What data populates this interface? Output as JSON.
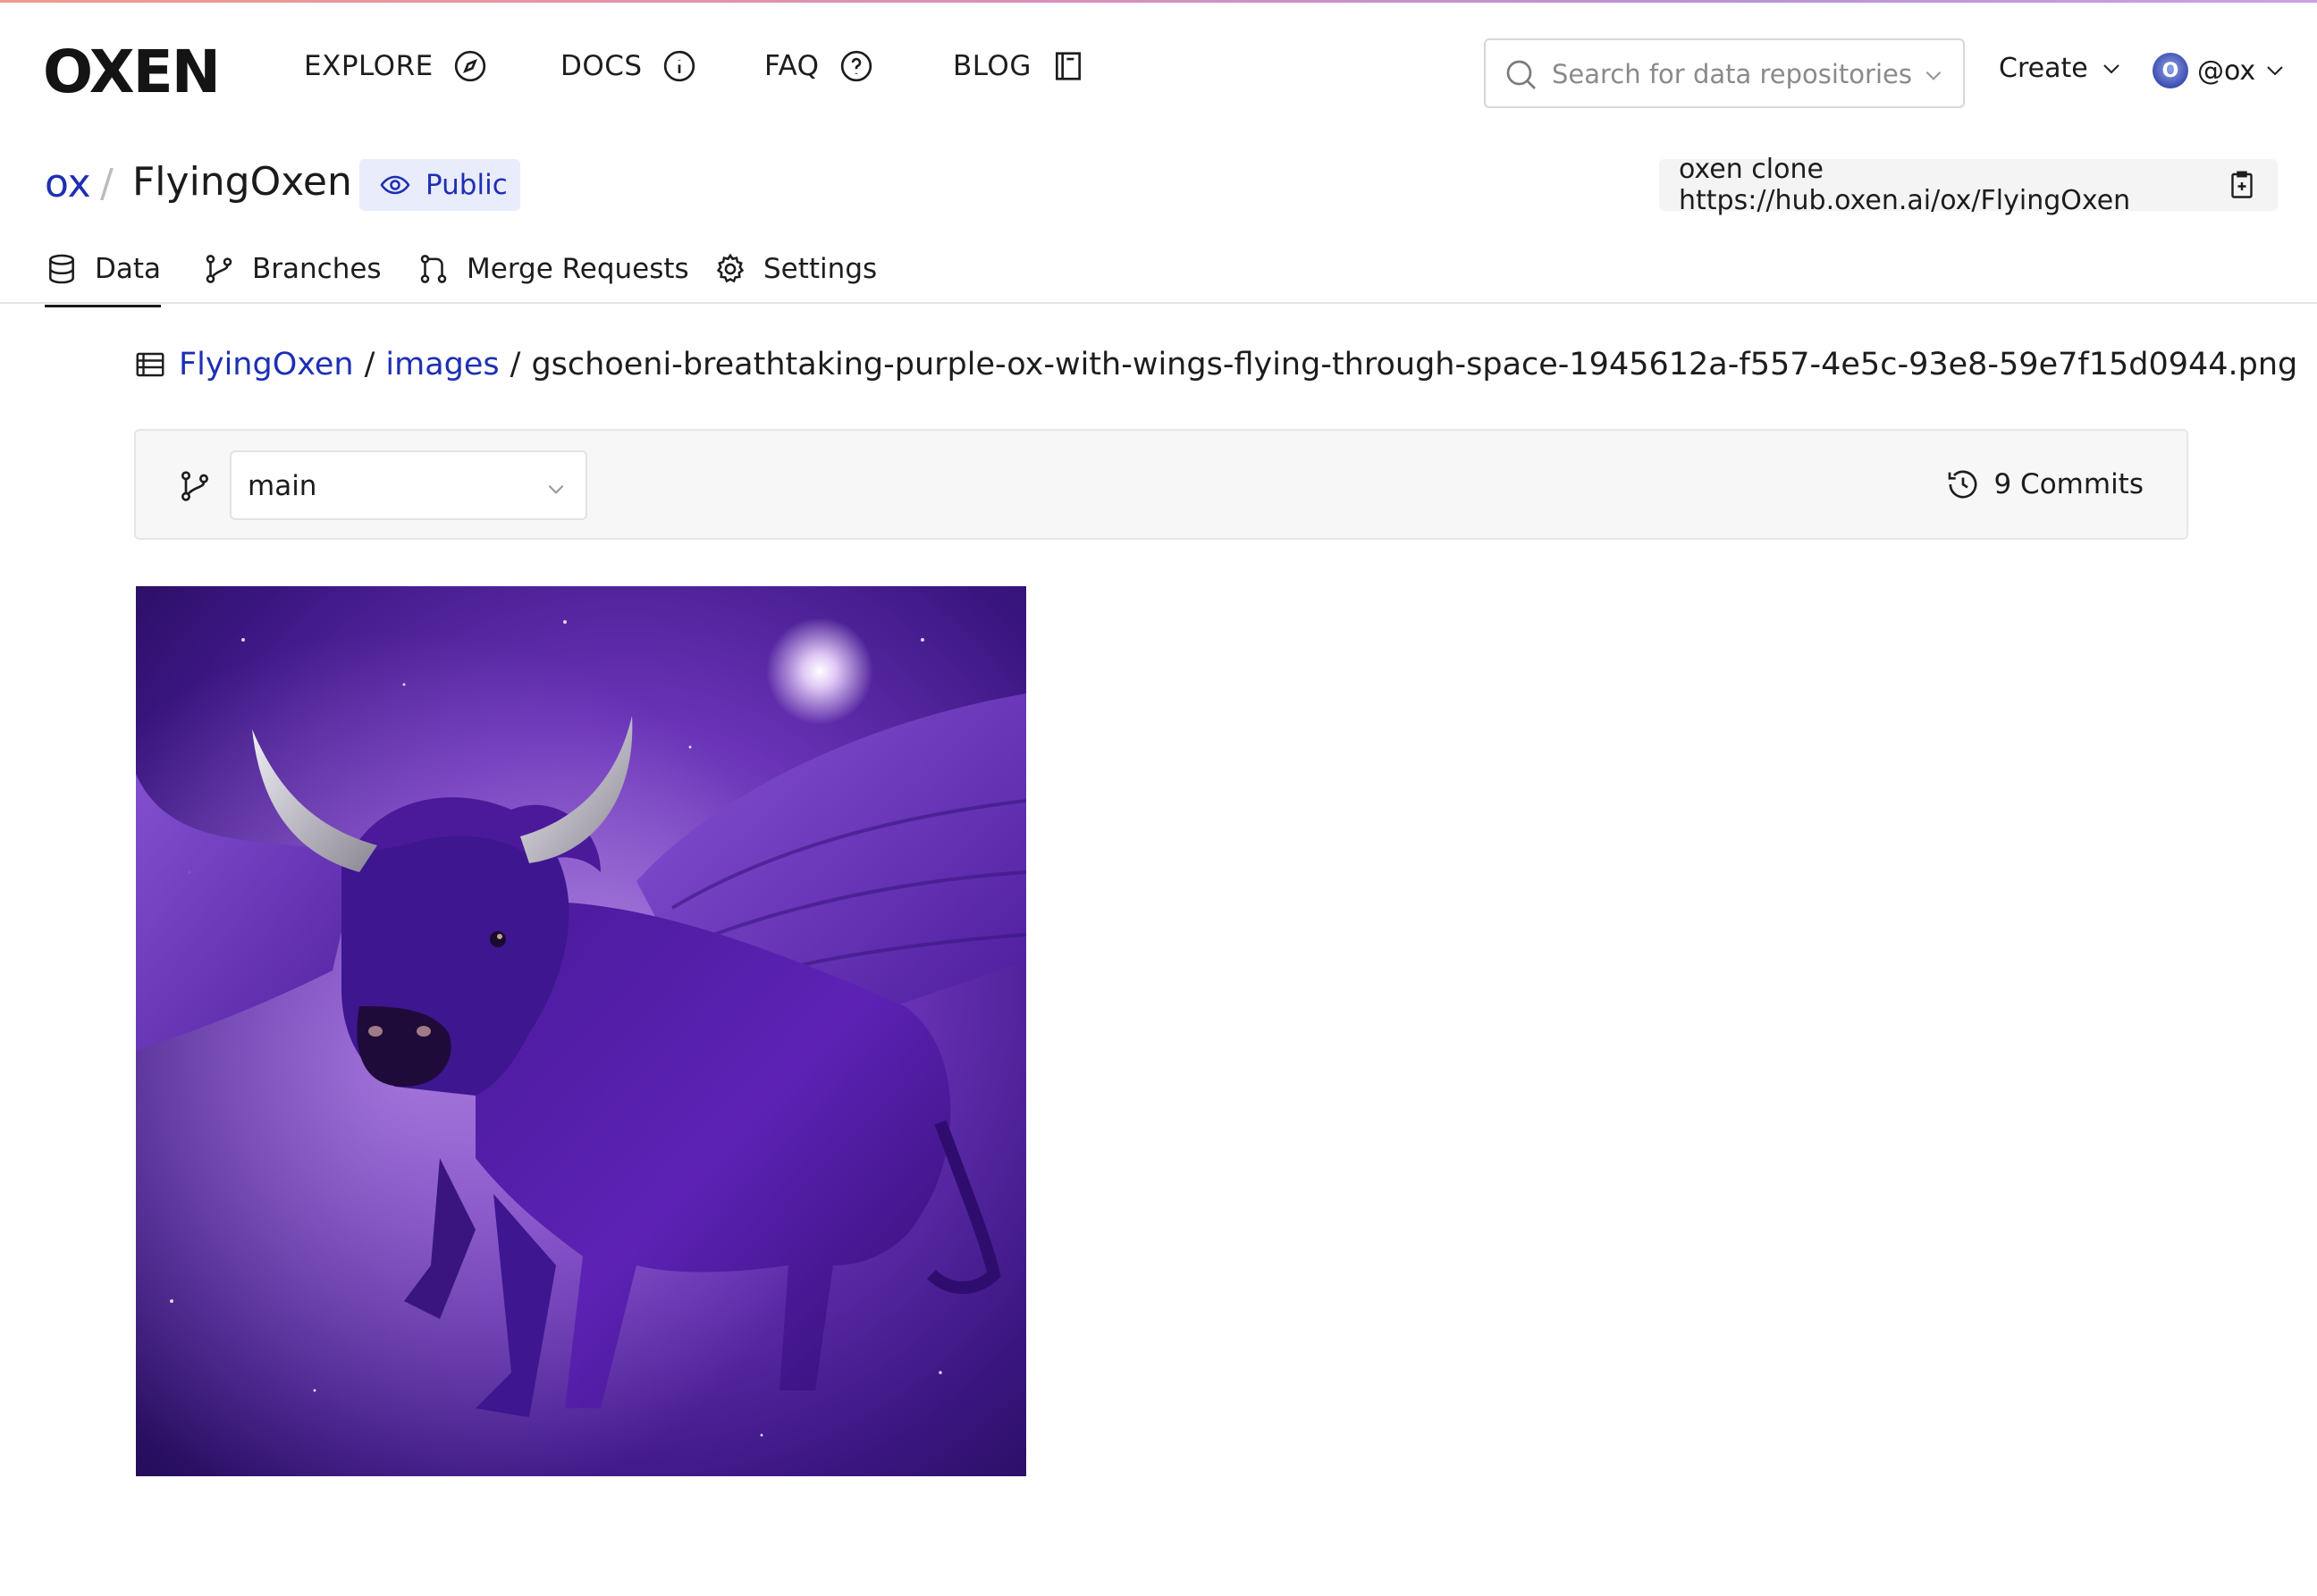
{
  "header": {
    "logo": "OXEN",
    "nav": [
      {
        "label": "EXPLORE",
        "icon": "compass-icon"
      },
      {
        "label": "DOCS",
        "icon": "info-icon"
      },
      {
        "label": "FAQ",
        "icon": "question-icon"
      },
      {
        "label": "BLOG",
        "icon": "book-icon"
      }
    ],
    "search_placeholder": "Search for data repositories",
    "create_label": "Create",
    "avatar_letter": "O",
    "username": "@ox"
  },
  "repo": {
    "owner": "ox",
    "separator": "/",
    "name": "FlyingOxen",
    "visibility": "Public",
    "clone_command": "oxen clone https://hub.oxen.ai/ox/FlyingOxen"
  },
  "tabs": [
    {
      "label": "Data",
      "icon": "database-icon",
      "active": true
    },
    {
      "label": "Branches",
      "icon": "branch-icon"
    },
    {
      "label": "Merge Requests",
      "icon": "merge-icon"
    },
    {
      "label": "Settings",
      "icon": "gear-icon"
    }
  ],
  "breadcrumb": {
    "root": "FlyingOxen",
    "folder": "images",
    "separator": "/",
    "file": "gschoeni-breathtaking-purple-ox-with-wings-flying-through-space-1945612a-f557-4e5c-93e8-59e7f15d0944.png"
  },
  "branch_bar": {
    "branch": "main",
    "commits_label": "9 Commits"
  },
  "colors": {
    "link": "#1e2fb4",
    "badge_bg": "#e9ecfb",
    "image_purple": "#5a1fa8"
  }
}
